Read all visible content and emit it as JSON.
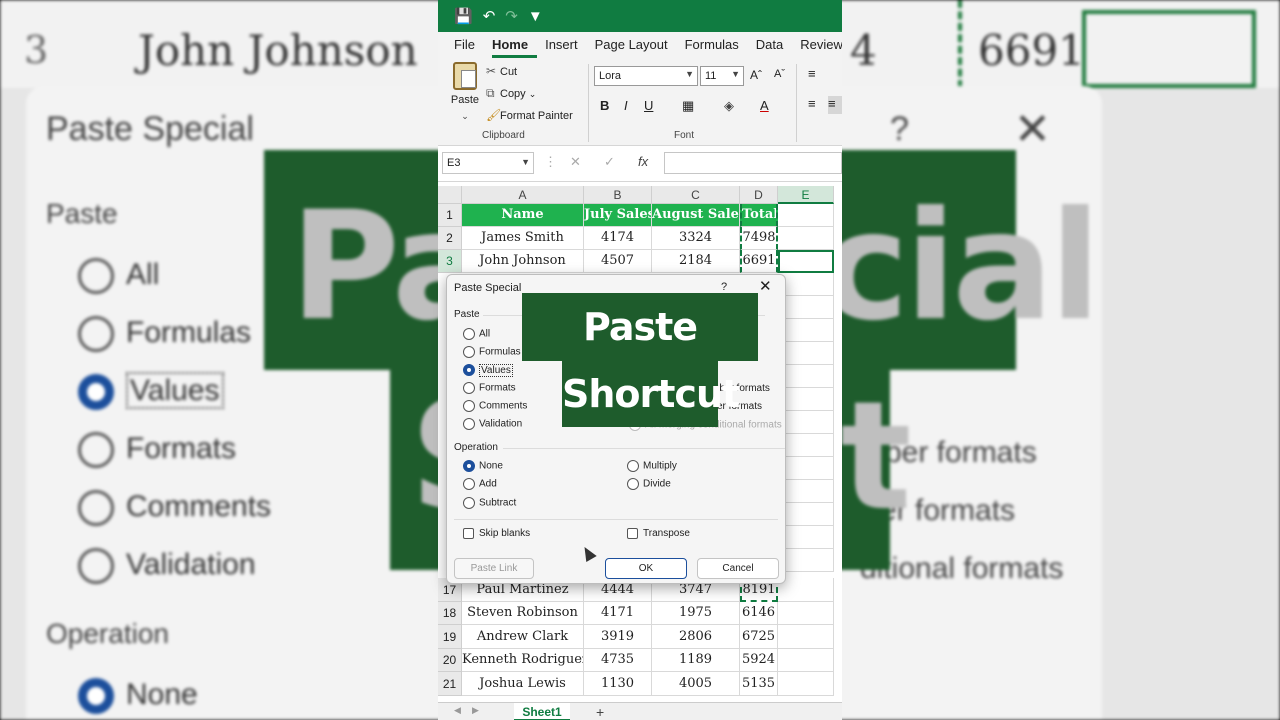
{
  "background": {
    "row_number": "3",
    "name": "John Johnson",
    "col_c_partial": "4",
    "total": "6691",
    "dialog_title": "Paste Special",
    "help": "?",
    "close": "✕",
    "paste_section": "Paste",
    "options": [
      "All",
      "Formulas",
      "Values",
      "Formats",
      "Comments",
      "Validation"
    ],
    "operation_section": "Operation",
    "op_none": "None",
    "right_partial": [
      "mber formats",
      "er formats",
      "ditional formats"
    ],
    "big_text_1": "Pas",
    "big_text_2": "cial",
    "big_text_3": "S",
    "big_text_4": "t"
  },
  "ribbon": {
    "tabs": [
      "File",
      "Home",
      "Insert",
      "Page Layout",
      "Formulas",
      "Data",
      "Review"
    ],
    "active_tab": "Home",
    "paste": "Paste",
    "cut": "Cut",
    "copy": "Copy",
    "format_painter": "Format Painter",
    "clipboard_group": "Clipboard",
    "font_name": "Lora",
    "font_size": "11",
    "font_group": "Font",
    "bold": "B",
    "italic": "I",
    "underline": "U"
  },
  "formula_bar": {
    "name_box": "E3",
    "fx": "fx"
  },
  "grid": {
    "columns": [
      "A",
      "B",
      "C",
      "D",
      "E"
    ],
    "header_row": [
      "Name",
      "July Sales",
      "August Sales",
      "Total"
    ],
    "rows_top": [
      {
        "num": "1"
      },
      {
        "num": "2",
        "cells": [
          "James Smith",
          "4174",
          "3324",
          "7498"
        ]
      },
      {
        "num": "3",
        "cells": [
          "John Johnson",
          "4507",
          "2184",
          "6691"
        ]
      }
    ],
    "rows_bottom": [
      {
        "num": "17",
        "cells": [
          "Paul Martinez",
          "4444",
          "3747",
          "8191"
        ]
      },
      {
        "num": "18",
        "cells": [
          "Steven Robinson",
          "4171",
          "1975",
          "6146"
        ]
      },
      {
        "num": "19",
        "cells": [
          "Andrew Clark",
          "3919",
          "2806",
          "6725"
        ]
      },
      {
        "num": "20",
        "cells": [
          "Kenneth Rodriguez",
          "4735",
          "1189",
          "5924"
        ]
      },
      {
        "num": "21",
        "cells": [
          "Joshua Lewis",
          "1130",
          "4005",
          "5135"
        ]
      }
    ],
    "sheet_tab": "Sheet1",
    "add_sheet": "+"
  },
  "dialog": {
    "title": "Paste Special",
    "help": "?",
    "close": "✕",
    "paste_section": "Paste",
    "paste_options": [
      "All",
      "Formulas",
      "Values",
      "Formats",
      "Comments",
      "Validation"
    ],
    "selected_paste": "Values",
    "right_options": [
      "mber formats",
      "er formats",
      "All merging conditional formats"
    ],
    "operation_section": "Operation",
    "op_left": [
      "None",
      "Add",
      "Subtract"
    ],
    "op_right": [
      "Multiply",
      "Divide"
    ],
    "selected_op": "None",
    "skip_blanks": "Skip blanks",
    "transpose": "Transpose",
    "paste_link": "Paste Link",
    "ok": "OK",
    "cancel": "Cancel"
  },
  "overlay": {
    "line1": "Paste Special",
    "line2": "Shortcut"
  }
}
